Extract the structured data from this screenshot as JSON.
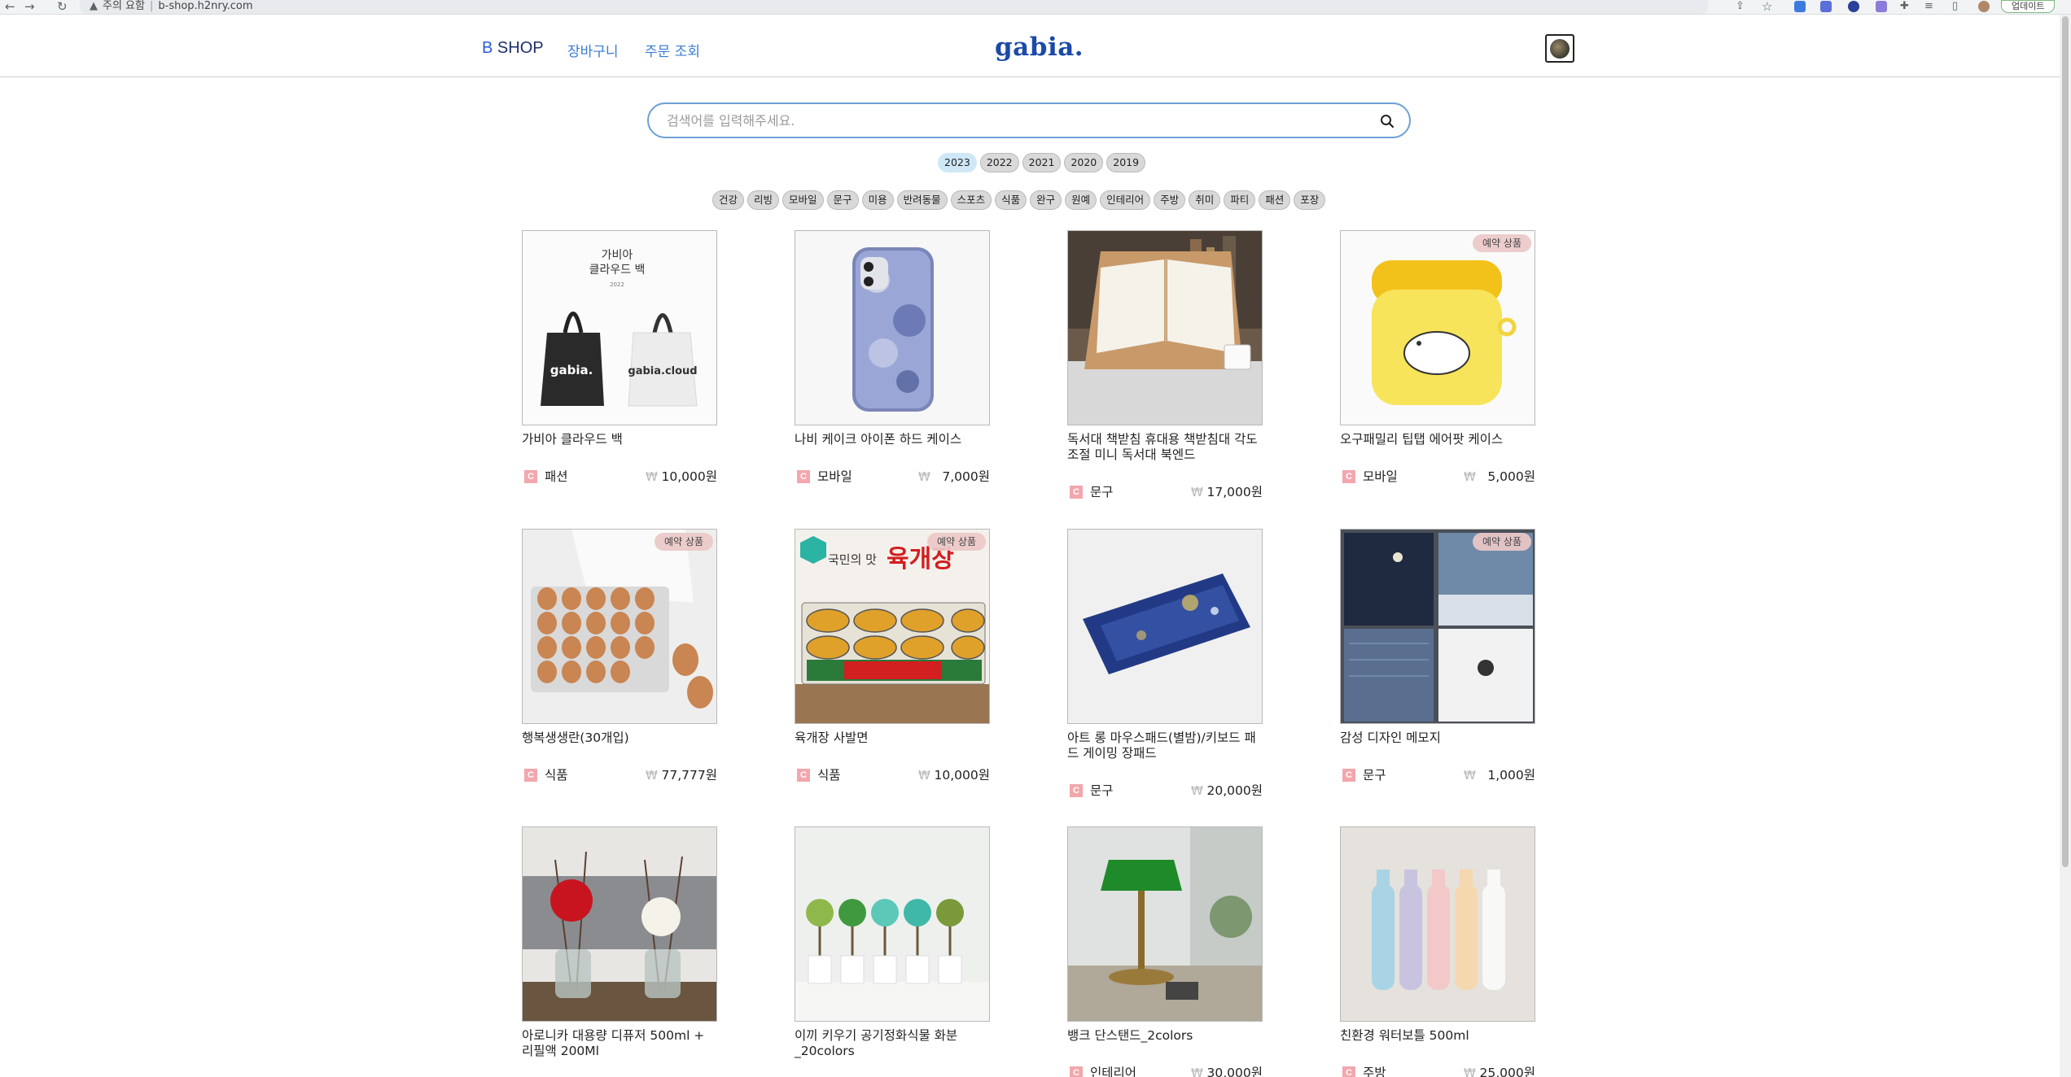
{
  "browser": {
    "security_label": "주의 요함",
    "url": "b-shop.h2nry.com",
    "update_label": "업데이트"
  },
  "header": {
    "brand_prefix": "B",
    "brand_name": "SHOP",
    "nav": [
      "장바구니",
      "주문 조회"
    ],
    "logo": "gabia."
  },
  "search": {
    "placeholder": "검색어를 입력해주세요.",
    "value": ""
  },
  "years": [
    "2023",
    "2022",
    "2021",
    "2020",
    "2019"
  ],
  "selected_year": "2023",
  "tags": [
    "건강",
    "리빙",
    "모바일",
    "문구",
    "미용",
    "반려동물",
    "스포츠",
    "식품",
    "완구",
    "원예",
    "인테리어",
    "주방",
    "취미",
    "파티",
    "패션",
    "포장"
  ],
  "colors": {
    "accent": "#3a7bd5",
    "logo": "#1b4aa8",
    "category_icon": "#f2a7ad",
    "active_year": "#cfe8f7",
    "badge": "#ecc8c8"
  },
  "category_icon_glyph": "C",
  "products": [
    {
      "name": "가비아 클라우드 백",
      "category": "패션",
      "price": "10,000원",
      "badge": "",
      "image_text": [
        "가비아",
        "클라우드 백",
        "2022"
      ],
      "bag_labels": [
        "gabia.",
        "gabia.cloud"
      ]
    },
    {
      "name": "나비 케이크 아이폰 하드 케이스",
      "category": "모바일",
      "price": "7,000원",
      "badge": ""
    },
    {
      "name": "독서대 책받침 휴대용 책받침대 각도조절 미니 독서대 북엔드",
      "category": "문구",
      "price": "17,000원",
      "badge": ""
    },
    {
      "name": "오구패밀리 팁탭 에어팟 케이스",
      "category": "모바일",
      "price": "5,000원",
      "badge": "예약 상품"
    },
    {
      "name": "행복생생란(30개입)",
      "category": "식품",
      "price": "77,777원",
      "badge": "예약 상품"
    },
    {
      "name": "육개장 사발면",
      "category": "식품",
      "price": "10,000원",
      "badge": "예약 상품",
      "image_text": [
        "국민의 맛",
        "육개장"
      ]
    },
    {
      "name": "아트 롱 마우스패드(별밤)/키보드 패드 게이밍 장패드",
      "category": "문구",
      "price": "20,000원",
      "badge": ""
    },
    {
      "name": "감성 디자인 메모지",
      "category": "문구",
      "price": "1,000원",
      "badge": "예약 상품"
    },
    {
      "name": "아로니카 대용량 디퓨저 500ml + 리필액 200Ml",
      "category": "",
      "price": "",
      "badge": ""
    },
    {
      "name": "이끼 키우기 공기정화식물 화분 _20colors",
      "category": "",
      "price": "",
      "badge": ""
    },
    {
      "name": "뱅크 단스탠드_2colors",
      "category": "인테리어",
      "price": "30,000원",
      "badge": ""
    },
    {
      "name": "친환경 워터보틀 500ml",
      "category": "주방",
      "price": "25,000원",
      "badge": ""
    }
  ]
}
